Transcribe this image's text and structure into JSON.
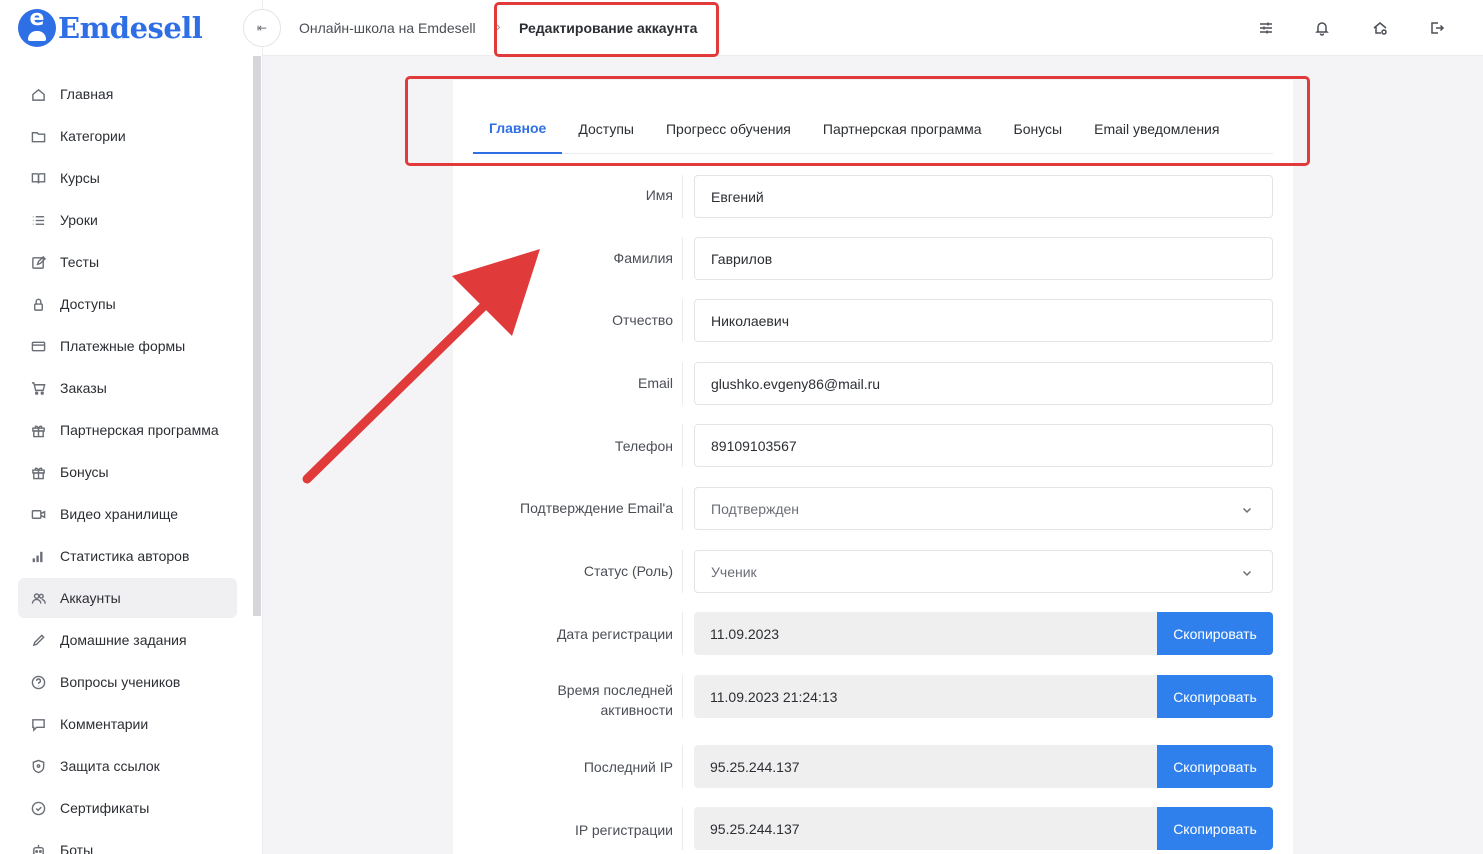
{
  "app": {
    "logo_text": "Emdesell",
    "logo_letter": "e"
  },
  "sidebar": {
    "items": [
      {
        "label": "Главная",
        "icon": "home-icon"
      },
      {
        "label": "Категории",
        "icon": "folder-icon"
      },
      {
        "label": "Курсы",
        "icon": "book-icon"
      },
      {
        "label": "Уроки",
        "icon": "list-icon"
      },
      {
        "label": "Тесты",
        "icon": "edit-icon"
      },
      {
        "label": "Доступы",
        "icon": "lock-icon"
      },
      {
        "label": "Платежные формы",
        "icon": "card-icon"
      },
      {
        "label": "Заказы",
        "icon": "cart-icon"
      },
      {
        "label": "Партнерская программа",
        "icon": "gift-icon"
      },
      {
        "label": "Бонусы",
        "icon": "gift-icon"
      },
      {
        "label": "Видео хранилище",
        "icon": "video-icon"
      },
      {
        "label": "Статистика авторов",
        "icon": "bar-chart-icon"
      },
      {
        "label": "Аккаунты",
        "icon": "users-icon"
      },
      {
        "label": "Домашние задания",
        "icon": "pencil-icon"
      },
      {
        "label": "Вопросы учеников",
        "icon": "question-icon"
      },
      {
        "label": "Комментарии",
        "icon": "comment-icon"
      },
      {
        "label": "Защита ссылок",
        "icon": "shield-icon"
      },
      {
        "label": "Сертификаты",
        "icon": "certificate-icon"
      },
      {
        "label": "Боты",
        "icon": "bot-icon"
      }
    ],
    "active_index": 12
  },
  "header": {
    "collapse_glyph": "⇤",
    "crumb_root": "Онлайн-школа на Emdesell",
    "crumb_sep": "›",
    "crumb_current": "Редактирование аккаунта"
  },
  "tabs": [
    "Главное",
    "Доступы",
    "Прогресс обучения",
    "Партнерская программа",
    "Бонусы",
    "Email уведомления"
  ],
  "form": {
    "first_name": {
      "label": "Имя",
      "value": "Евгений"
    },
    "last_name": {
      "label": "Фамилия",
      "value": "Гаврилов"
    },
    "middle_name": {
      "label": "Отчество",
      "value": "Николаевич"
    },
    "email": {
      "label": "Email",
      "value": "glushko.evgeny86@mail.ru"
    },
    "phone": {
      "label": "Телефон",
      "value": "89109103567"
    },
    "email_confirm": {
      "label": "Подтверждение Email'а",
      "value": "Подтвержден"
    },
    "role": {
      "label": "Статус (Роль)",
      "value": "Ученик"
    },
    "reg_date": {
      "label": "Дата регистрации",
      "value": "11.09.2023"
    },
    "last_active_label_1": "Время последней",
    "last_active_label_2": "активности",
    "last_active": {
      "value": "11.09.2023 21:24:13"
    },
    "last_ip": {
      "label": "Последний IP",
      "value": "95.25.244.137"
    },
    "reg_ip": {
      "label": "IP регистрации",
      "value": "95.25.244.137"
    },
    "copy_label": "Скопировать"
  },
  "colors": {
    "accent": "#2f6fe6",
    "button": "#2f80ed",
    "annotation": "#e03a3a"
  }
}
